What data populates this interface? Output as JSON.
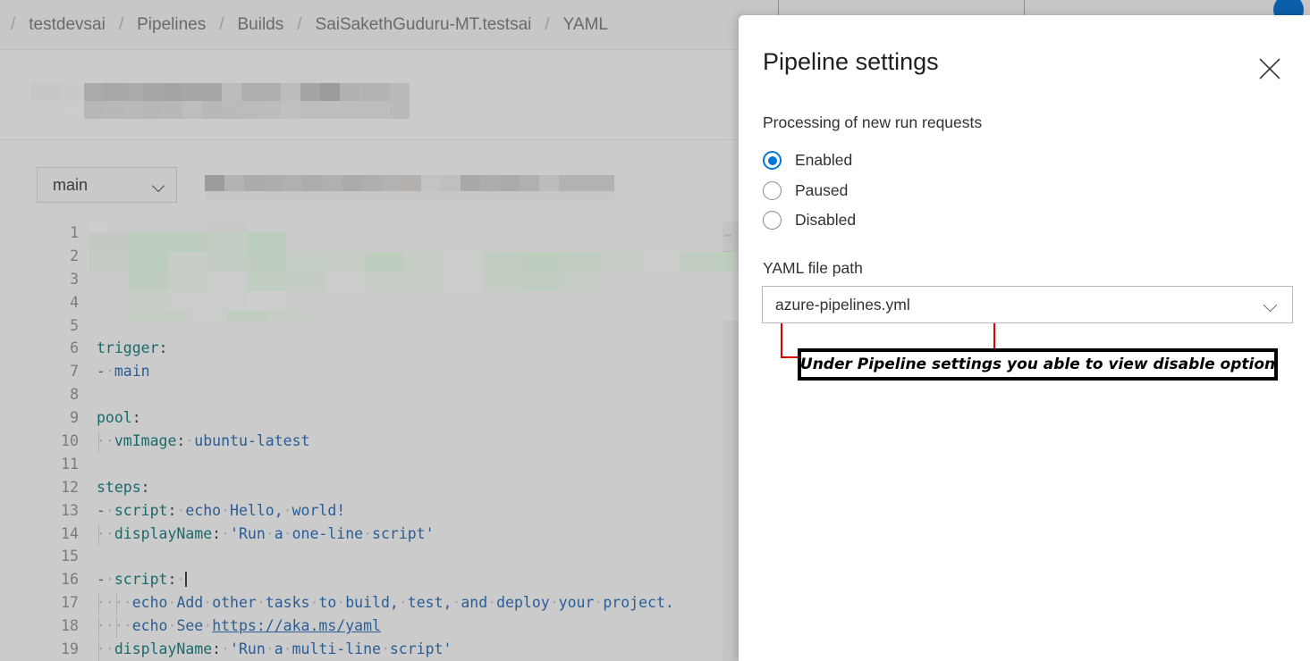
{
  "breadcrumb": {
    "separator": "/",
    "items": [
      {
        "label": "testdevsai"
      },
      {
        "label": "Pipelines"
      },
      {
        "label": "Builds"
      },
      {
        "label": "SaiSakethGuduru-MT.testsai"
      },
      {
        "label": "YAML"
      }
    ]
  },
  "toolbar": {
    "branch": "main",
    "branch_icon": "chevron-down-icon"
  },
  "editor": {
    "lines": [
      {
        "n": "1",
        "redacted": true,
        "tokens": []
      },
      {
        "n": "2",
        "redacted": true,
        "tokens": []
      },
      {
        "n": "3",
        "redacted": true,
        "tokens": []
      },
      {
        "n": "4",
        "redacted": true,
        "tokens": []
      },
      {
        "n": "5",
        "redacted": false,
        "text": ""
      },
      {
        "n": "6",
        "redacted": false,
        "text": "trigger:"
      },
      {
        "n": "7",
        "redacted": false,
        "text": "- main"
      },
      {
        "n": "8",
        "redacted": false,
        "text": ""
      },
      {
        "n": "9",
        "redacted": false,
        "text": "pool:"
      },
      {
        "n": "10",
        "redacted": false,
        "text": "  vmImage: ubuntu-latest"
      },
      {
        "n": "11",
        "redacted": false,
        "text": ""
      },
      {
        "n": "12",
        "redacted": false,
        "text": "steps:"
      },
      {
        "n": "13",
        "redacted": false,
        "text": "- script: echo Hello, world!"
      },
      {
        "n": "14",
        "redacted": false,
        "text": "  displayName: 'Run a one-line script'"
      },
      {
        "n": "15",
        "redacted": false,
        "text": ""
      },
      {
        "n": "16",
        "redacted": false,
        "text": "- script: |"
      },
      {
        "n": "17",
        "redacted": false,
        "text": "     echo Add other tasks to build, test, and deploy your project."
      },
      {
        "n": "18",
        "redacted": false,
        "text": "     echo See https://aka.ms/yaml"
      },
      {
        "n": "19",
        "redacted": false,
        "text": "  displayName: 'Run a multi-line script'"
      }
    ],
    "link_text": "https://aka.ms/yaml"
  },
  "panel": {
    "title": "Pipeline settings",
    "close_icon": "close-icon",
    "processing_label": "Processing of new run requests",
    "radio_options": [
      {
        "label": "Enabled",
        "selected": true
      },
      {
        "label": "Paused",
        "selected": false
      },
      {
        "label": "Disabled",
        "selected": false
      }
    ],
    "yaml_label": "YAML file path",
    "yaml_value": "azure-pipelines.yml",
    "yaml_dropdown_icon": "chevron-down-icon"
  },
  "annotation": {
    "callout_text": "Under Pipeline settings you able to view disable option",
    "highlight_color": "#e00000",
    "callout_border_color": "#000000"
  },
  "colors": {
    "accent": "#0078d4",
    "panel_bg": "#ffffff",
    "scrim": "#cbcbcb",
    "yaml_key": "#186b6b",
    "yaml_value": "#2a5d96"
  }
}
